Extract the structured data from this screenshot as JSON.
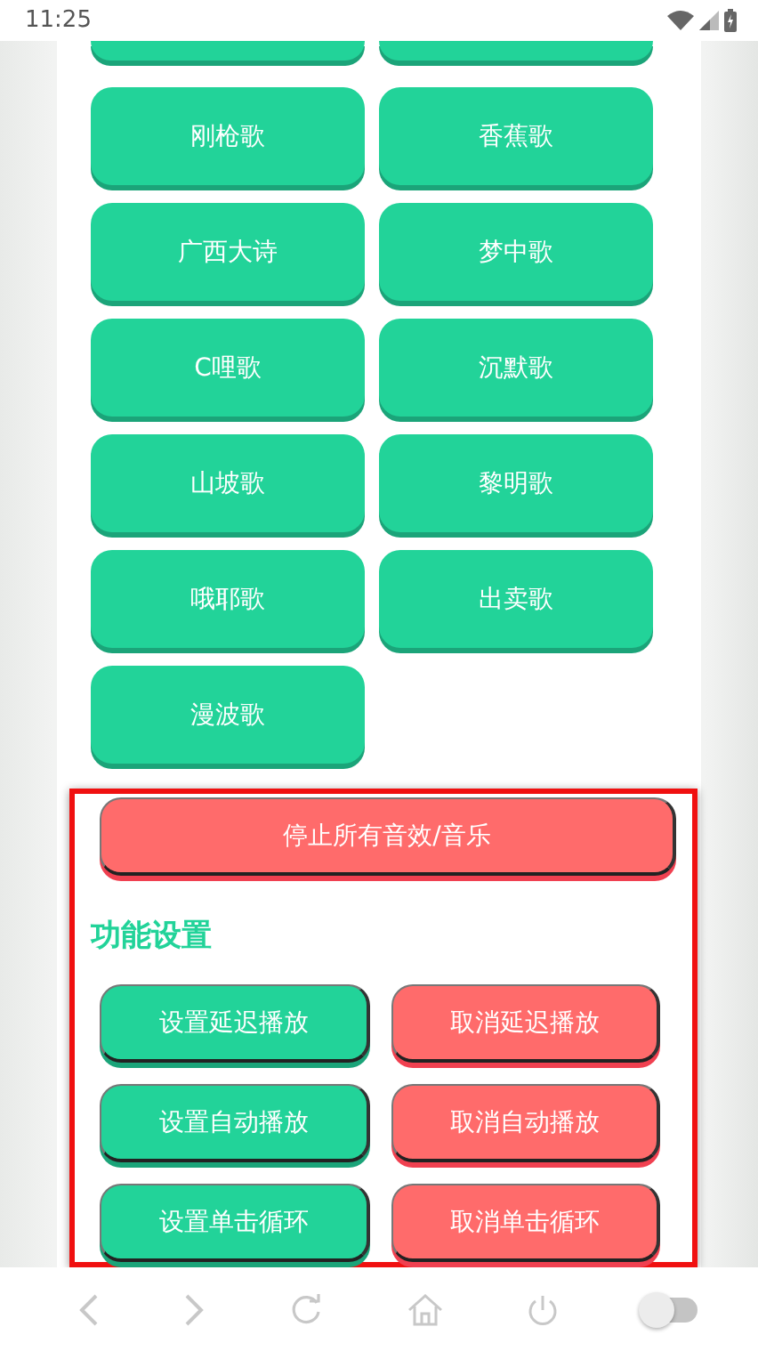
{
  "status_bar": {
    "time": "11:25"
  },
  "songs": [
    "刚枪歌",
    "香蕉歌",
    "广西大诗",
    "梦中歌",
    "C哩歌",
    "沉默歌",
    "山坡歌",
    "黎明歌",
    "哦耶歌",
    "出卖歌",
    "漫波歌"
  ],
  "stop_button": "停止所有音效/音乐",
  "settings": {
    "title": "功能设置",
    "buttons": [
      {
        "label": "设置延迟播放",
        "kind": "set"
      },
      {
        "label": "取消延迟播放",
        "kind": "cancel"
      },
      {
        "label": "设置自动播放",
        "kind": "set"
      },
      {
        "label": "取消自动播放",
        "kind": "cancel"
      },
      {
        "label": "设置单击循环",
        "kind": "set"
      },
      {
        "label": "取消单击循环",
        "kind": "cancel"
      }
    ]
  },
  "nav_bar": {
    "switch": {
      "on": false
    }
  }
}
